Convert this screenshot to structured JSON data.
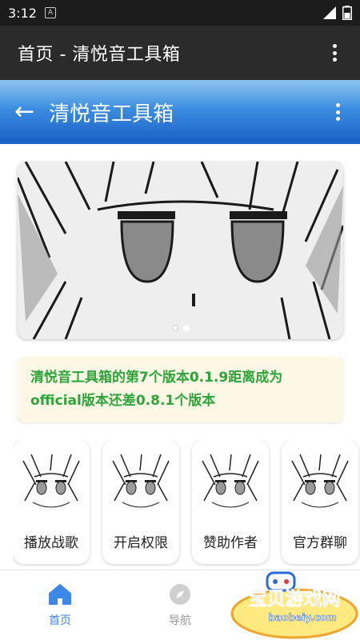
{
  "status_bar": {
    "time": "3:12",
    "notif_glyph": "A"
  },
  "app_bar": {
    "title": "首页 - 清悦音工具箱"
  },
  "page_header": {
    "back_glyph": "←",
    "title": "清悦音工具箱"
  },
  "notice": {
    "text": "清悦音工具箱的第7个版本0.1.9距离成为official版本还差0.8.1个版本"
  },
  "features": [
    {
      "label": "播放战歌"
    },
    {
      "label": "开启权限"
    },
    {
      "label": "赞助作者"
    },
    {
      "label": "官方群聊"
    }
  ],
  "bottom_nav": [
    {
      "label": "首页",
      "icon": "home-icon",
      "active": true
    },
    {
      "label": "导航",
      "icon": "compass-icon",
      "active": false
    }
  ],
  "watermark": {
    "title": "宝贝游戏网",
    "url": "baobeiy.com"
  },
  "colors": {
    "accent": "#3c86e6",
    "notice_text": "#2ea53a",
    "notice_bg": "#fdf7e6",
    "header_blue": "#1a5fc4"
  }
}
